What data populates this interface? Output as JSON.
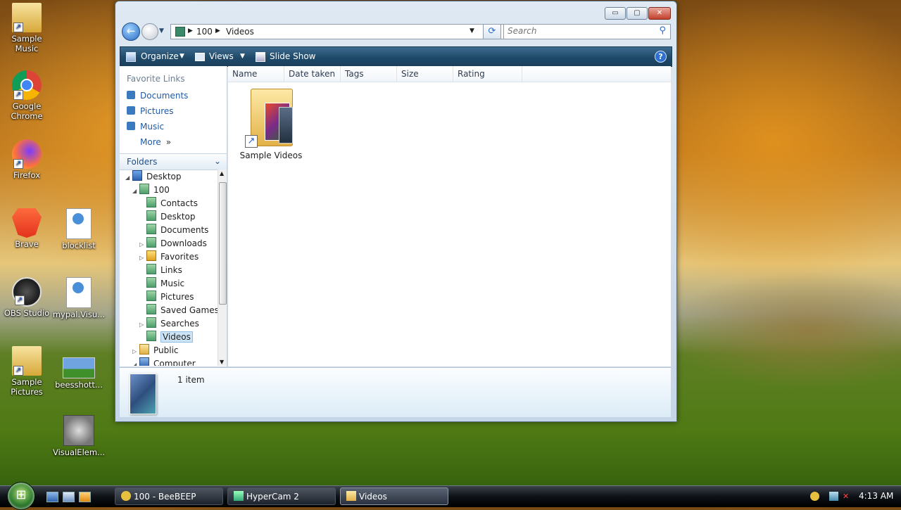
{
  "desktop": {
    "icons": [
      {
        "label": "Sample Music"
      },
      {
        "label": "Google Chrome"
      },
      {
        "label": "Firefox"
      },
      {
        "label": "Brave"
      },
      {
        "label": "blocklist"
      },
      {
        "label": "OBS Studio"
      },
      {
        "label": "mypal.Visu..."
      },
      {
        "label": "Sample Pictures"
      },
      {
        "label": "beesshott..."
      },
      {
        "label": "VisualElem..."
      }
    ]
  },
  "window": {
    "caption_buttons": {
      "minimize": "▭",
      "maximize": "▢",
      "close": "✕"
    },
    "address": {
      "crumbs": [
        "100",
        "Videos"
      ]
    },
    "search": {
      "placeholder": "Search"
    },
    "toolbar": {
      "organize": "Organize",
      "views": "Views",
      "slideshow": "Slide Show",
      "help": "?"
    },
    "nav": {
      "favorite_links_title": "Favorite Links",
      "favorite_links": [
        "Documents",
        "Pictures",
        "Music"
      ],
      "more": "More",
      "folders_title": "Folders",
      "tree": [
        {
          "label": "Desktop"
        },
        {
          "label": "100"
        },
        {
          "label": "Contacts"
        },
        {
          "label": "Desktop"
        },
        {
          "label": "Documents"
        },
        {
          "label": "Downloads"
        },
        {
          "label": "Favorites"
        },
        {
          "label": "Links"
        },
        {
          "label": "Music"
        },
        {
          "label": "Pictures"
        },
        {
          "label": "Saved Games"
        },
        {
          "label": "Searches"
        },
        {
          "label": "Videos"
        },
        {
          "label": "Public"
        },
        {
          "label": "Computer"
        }
      ]
    },
    "columns": [
      "Name",
      "Date taken",
      "Tags",
      "Size",
      "Rating"
    ],
    "items": [
      {
        "label": "Sample Videos"
      }
    ],
    "details": {
      "count": "1 item"
    }
  },
  "taskbar": {
    "buttons": [
      {
        "label": "100 - BeeBEEP"
      },
      {
        "label": "HyperCam 2"
      },
      {
        "label": "Videos"
      }
    ],
    "clock": "4:13 AM"
  },
  "colors": {
    "accent": "#1f4a6a",
    "link": "#1e5aa8",
    "selection": "#cde4f7"
  }
}
